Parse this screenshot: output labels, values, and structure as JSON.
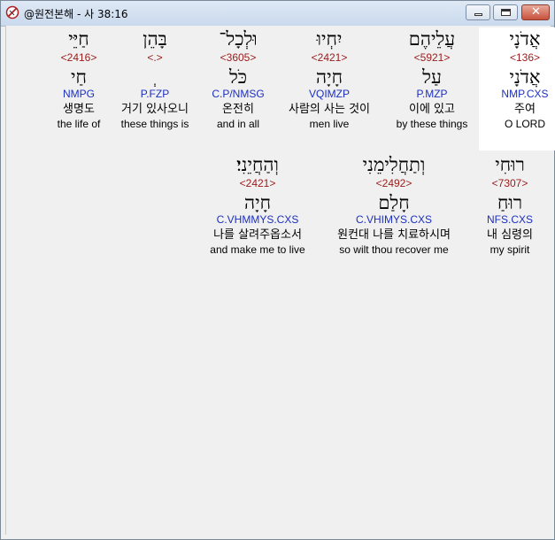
{
  "window": {
    "title": "@원전본해 - 사 38:16",
    "controls": {
      "minimize": "–",
      "maximize": "□",
      "close": "✕"
    }
  },
  "rows": [
    [
      {
        "hebrew": "אֲדֹנָי",
        "strong": "<136>",
        "lemma": "אֲדֹנָי",
        "morph": "NMP.CXS",
        "korean": "주여",
        "english": "O LORD",
        "selected": true
      },
      {
        "hebrew": "עֲלֵיהֶם",
        "strong": "<5921>",
        "lemma": "עַל",
        "morph": "P.MZP",
        "korean": "이에 있고",
        "english": "by these things"
      },
      {
        "hebrew": "יִחְיוּ",
        "strong": "<2421>",
        "lemma": "חָיָה",
        "morph": "VQIMZP",
        "korean": "사람의 사는 것이",
        "english": "men live"
      },
      {
        "hebrew": "וּלְכָל־",
        "strong": "<3605>",
        "lemma": "כֹּל",
        "morph": "C.P/NMSG",
        "korean": "온전히",
        "english": "and in all"
      },
      {
        "hebrew": "בָּהֵן",
        "strong": "<.>",
        "lemma": "ְ",
        "morph": "P.FZP",
        "korean": "거기 있사오니",
        "english": "these things is"
      },
      {
        "hebrew": "חַיֵּי",
        "strong": "<2416>",
        "lemma": "חַי",
        "morph": "NMPG",
        "korean": "생명도",
        "english": "the life of"
      }
    ],
    [
      {
        "hebrew": "רוּחִי",
        "strong": "<7307>",
        "lemma": "רוּחַ",
        "morph": "NFS.CXS",
        "korean": "내 심령의",
        "english": "my spirit"
      },
      {
        "hebrew": "וְתַחֲלִימֵנִי",
        "strong": "<2492>",
        "lemma": "חָלַם",
        "morph": "C.VHIMYS.CXS",
        "korean": "원컨대 나를 치료하시며",
        "english": "so wilt thou recover me"
      },
      {
        "hebrew": "וְהַחֲיֵנִי׃",
        "strong": "<2421>",
        "lemma": "חָיָה",
        "morph": "C.VHMMYS.CXS",
        "korean": "나를 살려주옵소서",
        "english": "and make me to live"
      }
    ]
  ]
}
